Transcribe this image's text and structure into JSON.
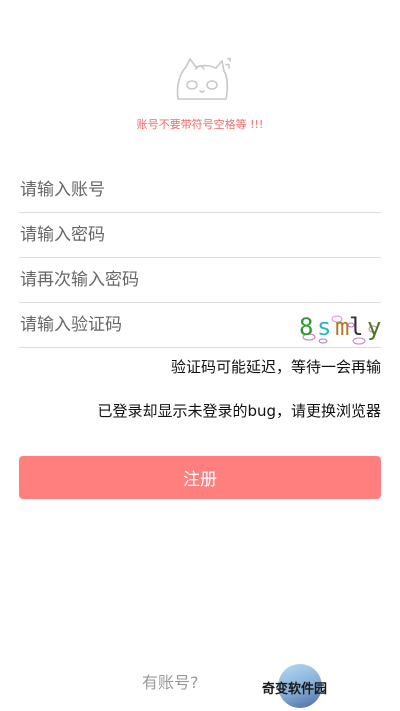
{
  "header": {
    "hint": "账号不要带符号空格等 !!!"
  },
  "form": {
    "account_placeholder": "请输入账号",
    "password_placeholder": "请输入密码",
    "confirm_placeholder": "请再次输入密码",
    "captcha_placeholder": "请输入验证码",
    "captcha": {
      "chars": [
        "8",
        "s",
        "m",
        "l",
        "y"
      ],
      "colors": [
        "#2e9a2e",
        "#2bb5c9",
        "#b07a2a",
        "#333333",
        "#4a7a1a"
      ]
    }
  },
  "notes": {
    "delay": "验证码可能延迟，等待一会再输",
    "bug": "已登录却显示未登录的bug，请更换浏览器"
  },
  "actions": {
    "register_label": "注册",
    "have_account_label": "有账号?"
  },
  "watermark": {
    "text": "奇变软件园"
  },
  "colors": {
    "accent": "#ff7f7f",
    "hint": "#f06a6a"
  }
}
